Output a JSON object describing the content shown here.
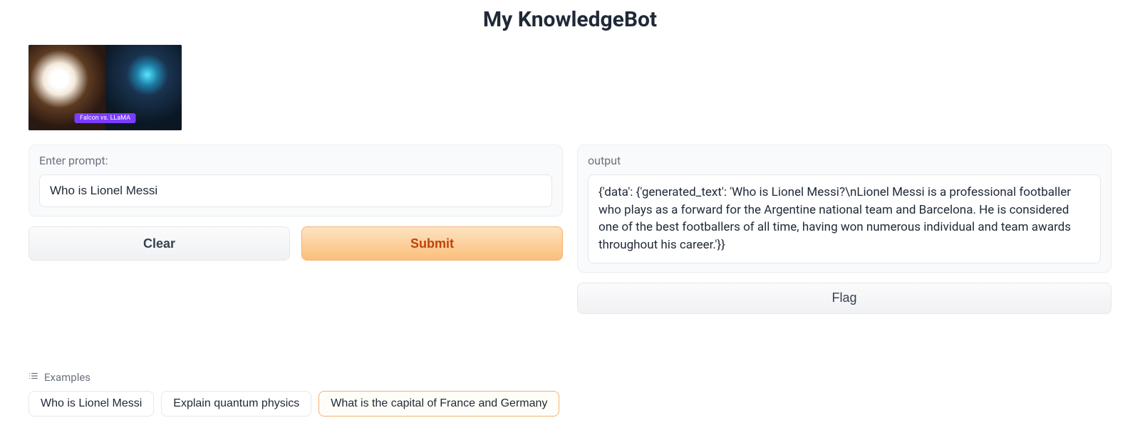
{
  "title": "My KnowledgeBot",
  "header_image": {
    "badge": "Falcon vs. LLaMA"
  },
  "input": {
    "label": "Enter prompt:",
    "value": "Who is Lionel Messi"
  },
  "buttons": {
    "clear": "Clear",
    "submit": "Submit",
    "flag": "Flag"
  },
  "output": {
    "label": "output",
    "value": "{'data': {'generated_text': 'Who is Lionel Messi?\\nLionel Messi is a professional footballer who plays as a forward for the Argentine national team and Barcelona. He is considered one of the best footballers of all time, having won numerous individual and team awards throughout his career.'}}"
  },
  "examples": {
    "label": "Examples",
    "items": [
      {
        "text": "Who is Lionel Messi",
        "active": false
      },
      {
        "text": "Explain quantum physics",
        "active": false
      },
      {
        "text": "What is the capital of France and Germany",
        "active": true
      }
    ]
  }
}
